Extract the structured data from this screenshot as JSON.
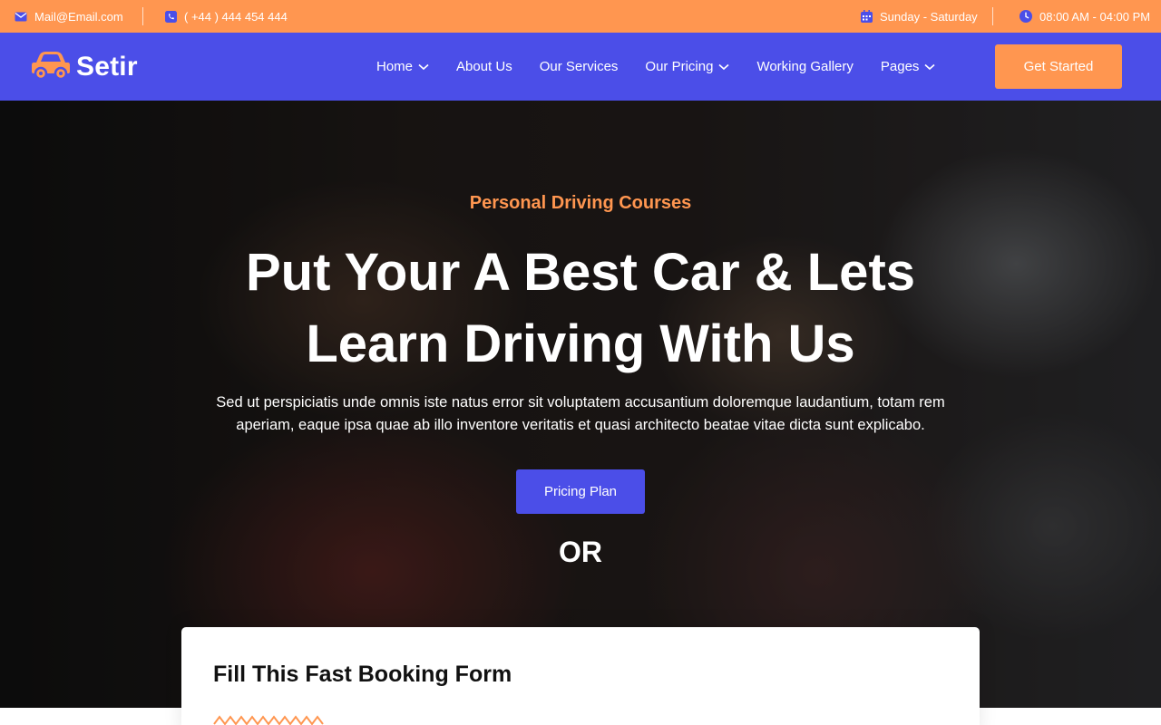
{
  "topbar": {
    "email": "Mail@Email.com",
    "phone": "( +44 ) 444 454 444",
    "days": "Sunday - Saturday",
    "hours": "08:00 AM - 04:00 PM",
    "icons": [
      "envelope-icon",
      "phone-icon",
      "calendar-icon",
      "clock-icon"
    ]
  },
  "brand": {
    "name": "Setir",
    "logo_icon": "car-icon"
  },
  "nav": {
    "items": [
      {
        "label": "Home",
        "dropdown": true
      },
      {
        "label": "About Us",
        "dropdown": false
      },
      {
        "label": "Our Services",
        "dropdown": false
      },
      {
        "label": "Our Pricing",
        "dropdown": true
      },
      {
        "label": "Working Gallery",
        "dropdown": false
      },
      {
        "label": "Pages",
        "dropdown": true
      }
    ],
    "cta_label": "Get Started"
  },
  "hero": {
    "tagline": "Personal Driving Courses",
    "title_line1": "Put Your A Best Car & Lets",
    "title_line2": "Learn Driving With Us",
    "description": "Sed ut perspiciatis unde omnis iste natus error sit voluptatem accusantium doloremque laudantium, totam rem aperiam, eaque ipsa quae ab illo inventore veritatis et quasi architecto beatae vitae dicta sunt explicabo.",
    "button_label": "Pricing Plan",
    "or_text": "OR"
  },
  "booking": {
    "title": "Fill This Fast Booking Form"
  },
  "colors": {
    "accent_orange": "#ff9650",
    "primary_blue": "#4b4ee8",
    "white": "#ffffff",
    "dark_text": "#111111"
  }
}
